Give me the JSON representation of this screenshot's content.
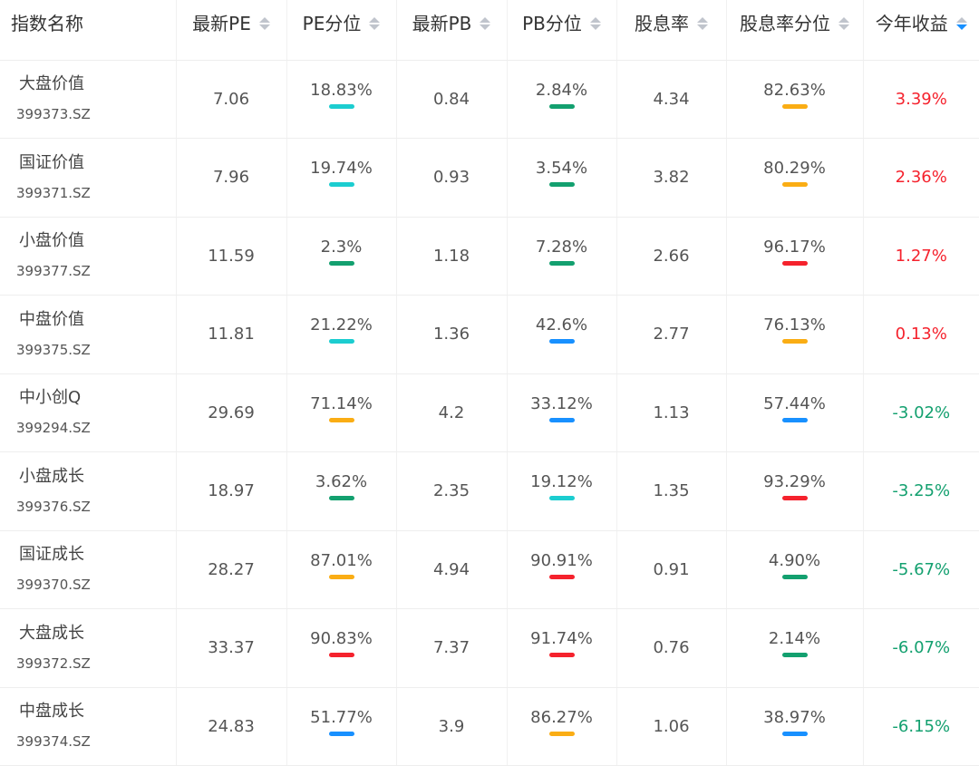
{
  "colors": {
    "cyan": "#1ccdd0",
    "green": "#13a06f",
    "blue": "#1890ff",
    "orange": "#faad14",
    "red": "#f5222d",
    "sort_inactive": "#c0c4cc",
    "sort_active": "#1890ff"
  },
  "header": {
    "name": "指数名称",
    "pe": "最新PE",
    "pe_pct": "PE分位",
    "pb": "最新PB",
    "pb_pct": "PB分位",
    "dy": "股息率",
    "dy_pct": "股息率分位",
    "ytd": "今年收益"
  },
  "rows": [
    {
      "name": "大盘价值",
      "code": "399373.SZ",
      "pe": "7.06",
      "pe_pct": "18.83%",
      "pe_bar": "cyan",
      "pb": "0.84",
      "pb_pct": "2.84%",
      "pb_bar": "green",
      "dy": "4.34",
      "dy_pct": "82.63%",
      "dy_bar": "orange",
      "ytd": "3.39%",
      "ytd_sign": "pos"
    },
    {
      "name": "国证价值",
      "code": "399371.SZ",
      "pe": "7.96",
      "pe_pct": "19.74%",
      "pe_bar": "cyan",
      "pb": "0.93",
      "pb_pct": "3.54%",
      "pb_bar": "green",
      "dy": "3.82",
      "dy_pct": "80.29%",
      "dy_bar": "orange",
      "ytd": "2.36%",
      "ytd_sign": "pos"
    },
    {
      "name": "小盘价值",
      "code": "399377.SZ",
      "pe": "11.59",
      "pe_pct": "2.3%",
      "pe_bar": "green",
      "pb": "1.18",
      "pb_pct": "7.28%",
      "pb_bar": "green",
      "dy": "2.66",
      "dy_pct": "96.17%",
      "dy_bar": "red",
      "ytd": "1.27%",
      "ytd_sign": "pos"
    },
    {
      "name": "中盘价值",
      "code": "399375.SZ",
      "pe": "11.81",
      "pe_pct": "21.22%",
      "pe_bar": "cyan",
      "pb": "1.36",
      "pb_pct": "42.6%",
      "pb_bar": "blue",
      "dy": "2.77",
      "dy_pct": "76.13%",
      "dy_bar": "orange",
      "ytd": "0.13%",
      "ytd_sign": "pos"
    },
    {
      "name": "中小创Q",
      "code": "399294.SZ",
      "pe": "29.69",
      "pe_pct": "71.14%",
      "pe_bar": "orange",
      "pb": "4.2",
      "pb_pct": "33.12%",
      "pb_bar": "blue",
      "dy": "1.13",
      "dy_pct": "57.44%",
      "dy_bar": "blue",
      "ytd": "-3.02%",
      "ytd_sign": "neg"
    },
    {
      "name": "小盘成长",
      "code": "399376.SZ",
      "pe": "18.97",
      "pe_pct": "3.62%",
      "pe_bar": "green",
      "pb": "2.35",
      "pb_pct": "19.12%",
      "pb_bar": "cyan",
      "dy": "1.35",
      "dy_pct": "93.29%",
      "dy_bar": "red",
      "ytd": "-3.25%",
      "ytd_sign": "neg"
    },
    {
      "name": "国证成长",
      "code": "399370.SZ",
      "pe": "28.27",
      "pe_pct": "87.01%",
      "pe_bar": "orange",
      "pb": "4.94",
      "pb_pct": "90.91%",
      "pb_bar": "red",
      "dy": "0.91",
      "dy_pct": "4.90%",
      "dy_bar": "green",
      "ytd": "-5.67%",
      "ytd_sign": "neg"
    },
    {
      "name": "大盘成长",
      "code": "399372.SZ",
      "pe": "33.37",
      "pe_pct": "90.83%",
      "pe_bar": "red",
      "pb": "7.37",
      "pb_pct": "91.74%",
      "pb_bar": "red",
      "dy": "0.76",
      "dy_pct": "2.14%",
      "dy_bar": "green",
      "ytd": "-6.07%",
      "ytd_sign": "neg"
    },
    {
      "name": "中盘成长",
      "code": "399374.SZ",
      "pe": "24.83",
      "pe_pct": "51.77%",
      "pe_bar": "blue",
      "pb": "3.9",
      "pb_pct": "86.27%",
      "pb_bar": "orange",
      "dy": "1.06",
      "dy_pct": "38.97%",
      "dy_bar": "blue",
      "ytd": "-6.15%",
      "ytd_sign": "neg"
    }
  ]
}
